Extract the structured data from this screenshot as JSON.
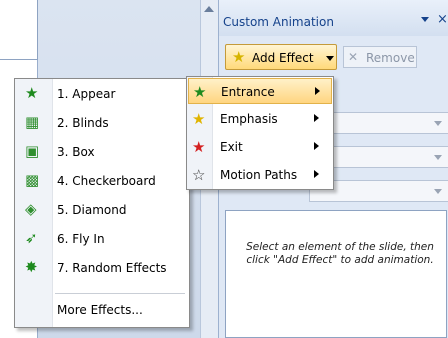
{
  "pane": {
    "title": "Custom Animation",
    "close_glyph": "×",
    "add_effect_label": "Add Effect",
    "remove_label": "Remove",
    "hint": "Select an element of the slide, then click \"Add Effect\" to add animation."
  },
  "submenu": {
    "items": [
      {
        "label": "Entrance",
        "icon": "entrance-star-icon",
        "glyph": "★",
        "color": "#1e8a1e",
        "highlighted": true
      },
      {
        "label": "Emphasis",
        "icon": "emphasis-star-icon",
        "glyph": "★",
        "color": "#e0b400"
      },
      {
        "label": "Exit",
        "icon": "exit-star-icon",
        "glyph": "★",
        "color": "#d42020"
      },
      {
        "label": "Motion Paths",
        "icon": "motion-path-star-icon",
        "glyph": "☆",
        "color": "#333333"
      }
    ]
  },
  "menu": {
    "items": [
      {
        "label": "1. Appear",
        "icon": "appear-icon"
      },
      {
        "label": "2. Blinds",
        "icon": "blinds-icon"
      },
      {
        "label": "3. Box",
        "icon": "box-icon"
      },
      {
        "label": "4. Checkerboard",
        "icon": "checkerboard-icon"
      },
      {
        "label": "5. Diamond",
        "icon": "diamond-icon"
      },
      {
        "label": "6. Fly In",
        "icon": "fly-in-icon"
      },
      {
        "label": "7. Random Effects",
        "icon": "random-effects-icon"
      }
    ],
    "more_label": "More Effects..."
  },
  "colors": {
    "accent_highlight": "#ffd580",
    "star_green": "#1e8a1e",
    "pane_title": "#15428b"
  }
}
